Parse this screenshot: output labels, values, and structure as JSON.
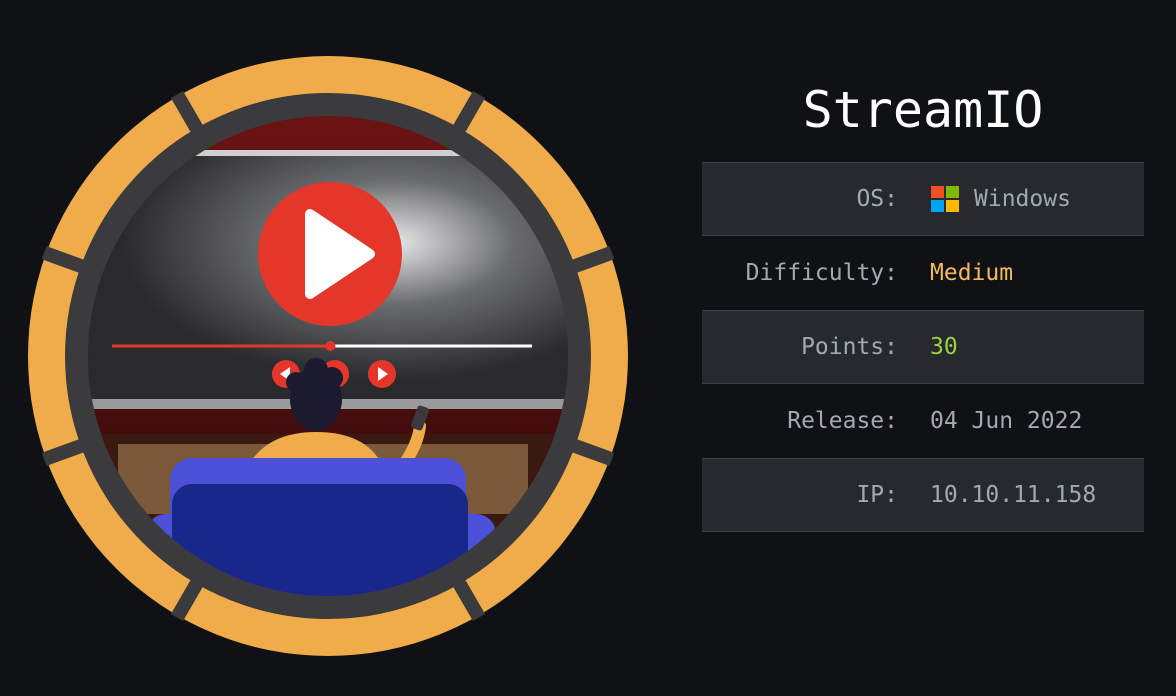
{
  "machine": {
    "name": "StreamIO"
  },
  "info": {
    "os_label": "OS:",
    "os_value": "Windows",
    "os_icon": "windows-logo-icon",
    "difficulty_label": "Difficulty:",
    "difficulty_value": "Medium",
    "difficulty_color": "#f5b85c",
    "points_label": "Points:",
    "points_value": "30",
    "points_color": "#9fd13c",
    "release_label": "Release:",
    "release_value": "04 Jun 2022",
    "ip_label": "IP:",
    "ip_value": "10.10.11.158"
  },
  "badge": {
    "icon": "streaming-machine-badge",
    "ring_color": "#f0ac4a",
    "play_color": "#e5362a",
    "seek_progress": 0.52
  }
}
